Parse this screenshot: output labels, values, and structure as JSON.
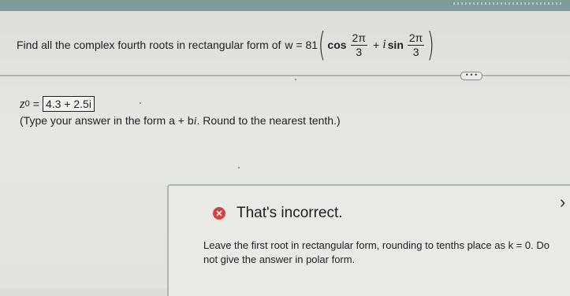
{
  "question": {
    "text": "Find all the complex fourth roots in rectangular form of",
    "formula": {
      "lhs": "w = 81",
      "cos": "cos",
      "frac_num": "2π",
      "frac_den": "3",
      "plus": "+",
      "i": "i",
      "sin": "sin"
    }
  },
  "toolbar": {
    "more_label": "• • •"
  },
  "answer": {
    "var": "z",
    "sub": "0",
    "equals": "=",
    "value": "4.3 + 2.5i"
  },
  "instructions": {
    "pre": "(Type your answer in the form ",
    "form_a": "a",
    "form_plus": " + ",
    "form_b": "b",
    "form_i": "i",
    "post": ". Round to the nearest tenth.)"
  },
  "feedback": {
    "title": "That's incorrect.",
    "body": "Leave the first root in rectangular form, rounding to tenths place as k = 0. Do not give the answer in polar form.",
    "icon": "x-circle-icon",
    "icon_color": "#d2453d"
  },
  "close_glyph": "›"
}
